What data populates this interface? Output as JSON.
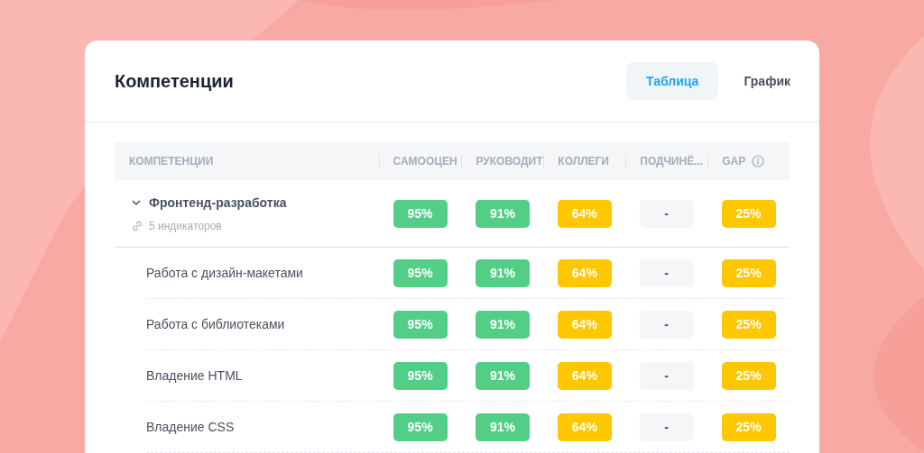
{
  "card": {
    "title": "Компетенции"
  },
  "tabs": [
    {
      "label": "Таблица",
      "selected": true
    },
    {
      "label": "График",
      "selected": false
    }
  ],
  "table": {
    "columns": [
      {
        "label": "КОМПЕТЕНЦИИ"
      },
      {
        "label": "САМООЦЕН"
      },
      {
        "label": "РУКОВОДИТ"
      },
      {
        "label": "КОЛЛЕГИ"
      },
      {
        "label": "ПОДЧИНЁ..."
      },
      {
        "label": "GAP",
        "info": true
      }
    ],
    "groups": [
      {
        "name": "Фронтенд-разработка",
        "expanded": true,
        "indicators": "5 индикаторов",
        "scores": [
          {
            "text": "95%",
            "color": "#52ce87"
          },
          {
            "text": "91%",
            "color": "#52ce87"
          },
          {
            "text": "64%",
            "color": "#ffc700"
          },
          {
            "text": "-",
            "color": "#f4f6f8"
          },
          {
            "text": "25%",
            "color": "#ffc700"
          }
        ],
        "children": [
          {
            "name": "Работа с дизайн-макетами",
            "scores": [
              {
                "text": "95%",
                "color": "#52ce87"
              },
              {
                "text": "91%",
                "color": "#52ce87"
              },
              {
                "text": "64%",
                "color": "#ffc700"
              },
              {
                "text": "-",
                "color": "#f4f6f8"
              },
              {
                "text": "25%",
                "color": "#ffc700"
              }
            ]
          },
          {
            "name": "Работа с библиотеками",
            "scores": [
              {
                "text": "95%",
                "color": "#52ce87"
              },
              {
                "text": "91%",
                "color": "#52ce87"
              },
              {
                "text": "64%",
                "color": "#ffc700"
              },
              {
                "text": "-",
                "color": "#f4f6f8"
              },
              {
                "text": "25%",
                "color": "#ffc700"
              }
            ]
          },
          {
            "name": "Владение HTML",
            "scores": [
              {
                "text": "95%",
                "color": "#52ce87"
              },
              {
                "text": "91%",
                "color": "#52ce87"
              },
              {
                "text": "64%",
                "color": "#ffc700"
              },
              {
                "text": "-",
                "color": "#f4f6f8"
              },
              {
                "text": "25%",
                "color": "#ffc700"
              }
            ]
          },
          {
            "name": "Владение CSS",
            "scores": [
              {
                "text": "95%",
                "color": "#52ce87"
              },
              {
                "text": "91%",
                "color": "#52ce87"
              },
              {
                "text": "64%",
                "color": "#ffc700"
              },
              {
                "text": "-",
                "color": "#f4f6f8"
              },
              {
                "text": "25%",
                "color": "#ffc700"
              }
            ]
          }
        ]
      }
    ]
  }
}
